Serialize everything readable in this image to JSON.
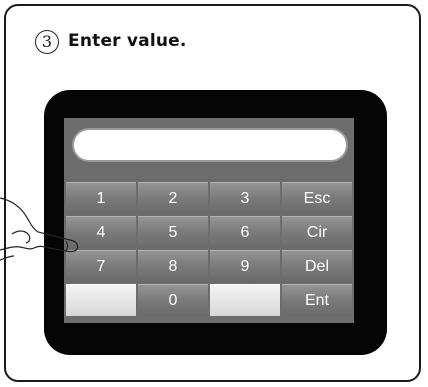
{
  "step": {
    "number": "3",
    "title": "Enter value."
  },
  "keypad": {
    "keys": [
      "1",
      "2",
      "3",
      "Esc",
      "4",
      "5",
      "6",
      "Cir",
      "7",
      "8",
      "9",
      "Del",
      "",
      "0",
      "",
      "Ent"
    ]
  },
  "colors": {
    "key_face": "#7a7a7a",
    "screen_bg": "#6c6c6c",
    "device_bezel": "#050505",
    "blank_key": "#e6e6e6"
  }
}
